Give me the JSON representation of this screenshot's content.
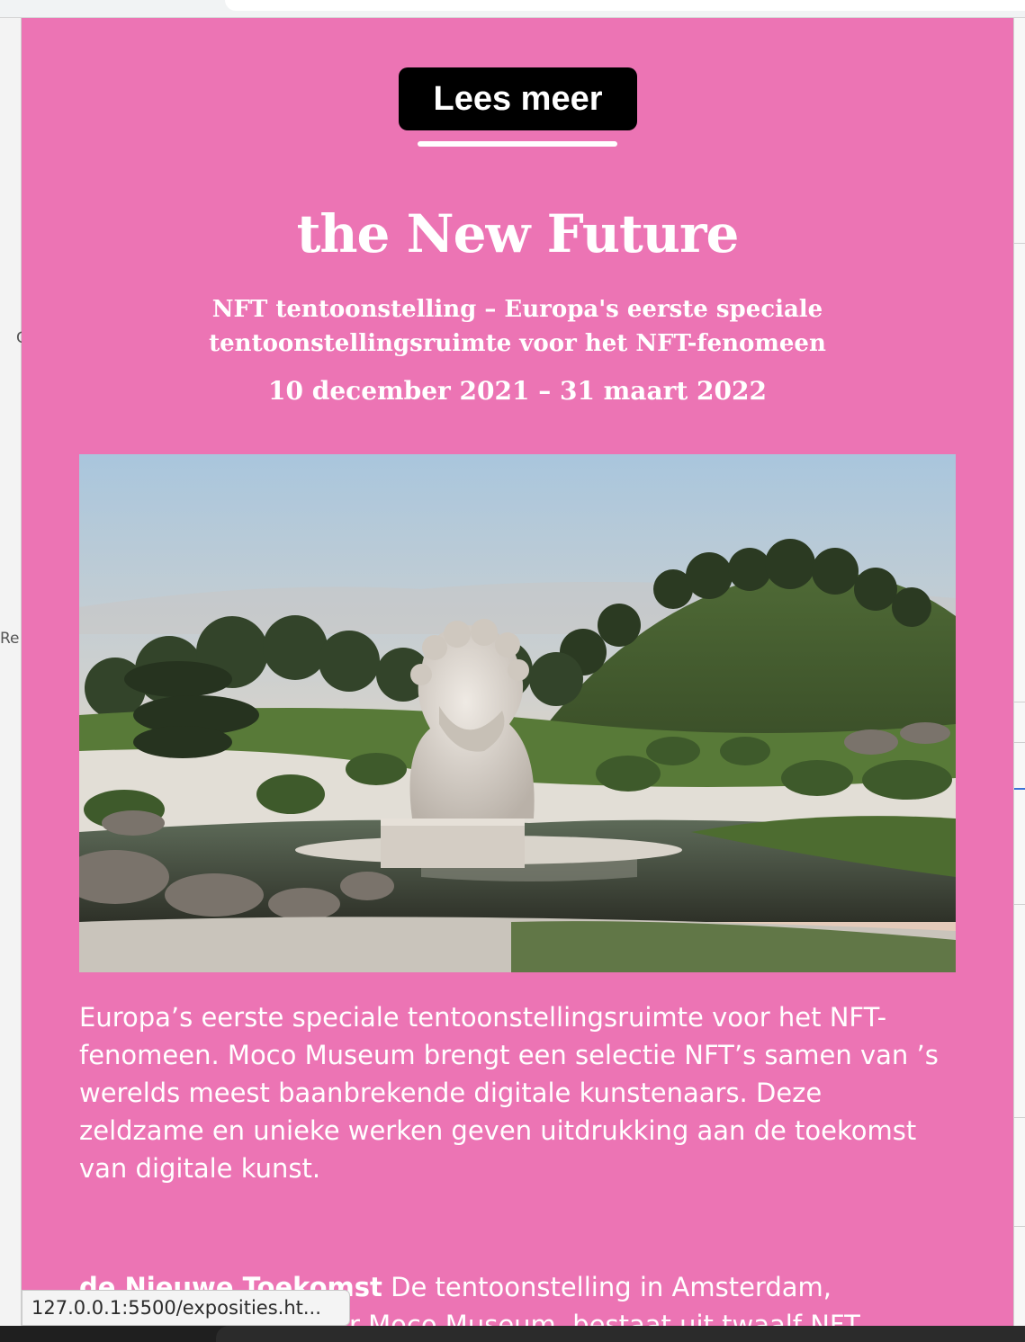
{
  "button": {
    "label": "Lees meer"
  },
  "title": "the New Future",
  "subtitle": "NFT tentoonstelling – Europa's eerste speciale tentoonstellingsruimte voor het NFT-fenomeen",
  "dates": "10 december 2021 – 31 maart 2022",
  "body": {
    "paragraph": "Europa’s eerste speciale tentoonstellingsruimte voor het NFT-fenomeen. Moco Museum brengt een selectie NFT’s samen van ’s werelds meest baanbrekende digitale kunstenaars. Deze zeldzame en unieke werken geven uitdrukking aan de toekomst van digitale kunst.",
    "second_bold": "de Nieuwe Toekomst",
    "second_line1": " De tentoonstelling in Amsterdam,",
    "second_line2": "r Moco Museum, bestaat uit twaalf NFT"
  },
  "status_bar": {
    "url": "127.0.0.1:5500/exposities.ht..."
  },
  "left_sliver": {
    "glyph_1": "C",
    "glyph_2": "Re"
  },
  "colors": {
    "page_bg": "#ec74b4",
    "button_bg": "#000000",
    "text": "#ffffff"
  },
  "icons": {
    "hero_image": "sculpture-garden-image"
  }
}
